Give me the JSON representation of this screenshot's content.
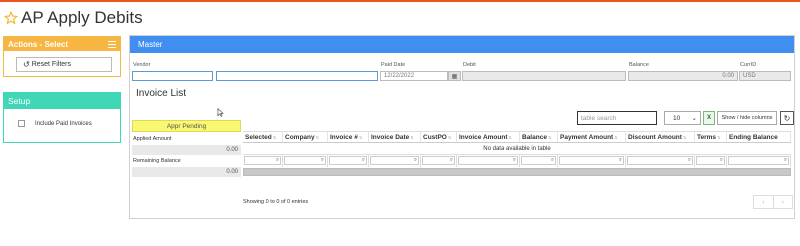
{
  "page": {
    "title": "AP Apply Debits",
    "accent": "#e9541f"
  },
  "actions": {
    "title": "Actions - Select",
    "color": "#f7b542",
    "reset_label": "Reset Filters"
  },
  "setup": {
    "title": "Setup",
    "color": "#3fd7b6",
    "include_paid_label": "Include Paid Invoices",
    "include_paid_checked": false
  },
  "master": {
    "title": "Master",
    "color": "#3f8ef0",
    "vendor_label": "Vendor",
    "vendor_code": "",
    "vendor_name": "",
    "paid_date_label": "Paid Date",
    "paid_date": "12/22/2022",
    "debit_label": "Debit",
    "debit": "",
    "balance_label": "Balance",
    "balance": "0.00",
    "curr_label": "CurrID",
    "curr": "USD"
  },
  "invoice_list": {
    "title": "Invoice List",
    "search_placeholder": "table search",
    "page_length": "10",
    "excel_label": "X",
    "colvis_label": "Show / hide columns",
    "appr_pending": "Appr Pending",
    "applied_amount_label": "Applied Amount",
    "applied_amount": "0.00",
    "remaining_balance_label": "Remaining Balance",
    "remaining_balance": "0.00",
    "columns": [
      "Selected",
      "Company",
      "Invoice #",
      "Invoice Date",
      "CustPO",
      "Invoice Amount",
      "Balance",
      "Payment Amount",
      "Discount Amount",
      "Terms",
      "Ending Balance"
    ],
    "empty_message": "No data available in table",
    "info": "Showing 0 to 0 of 0 entries",
    "prev": "‹",
    "next": "›"
  }
}
